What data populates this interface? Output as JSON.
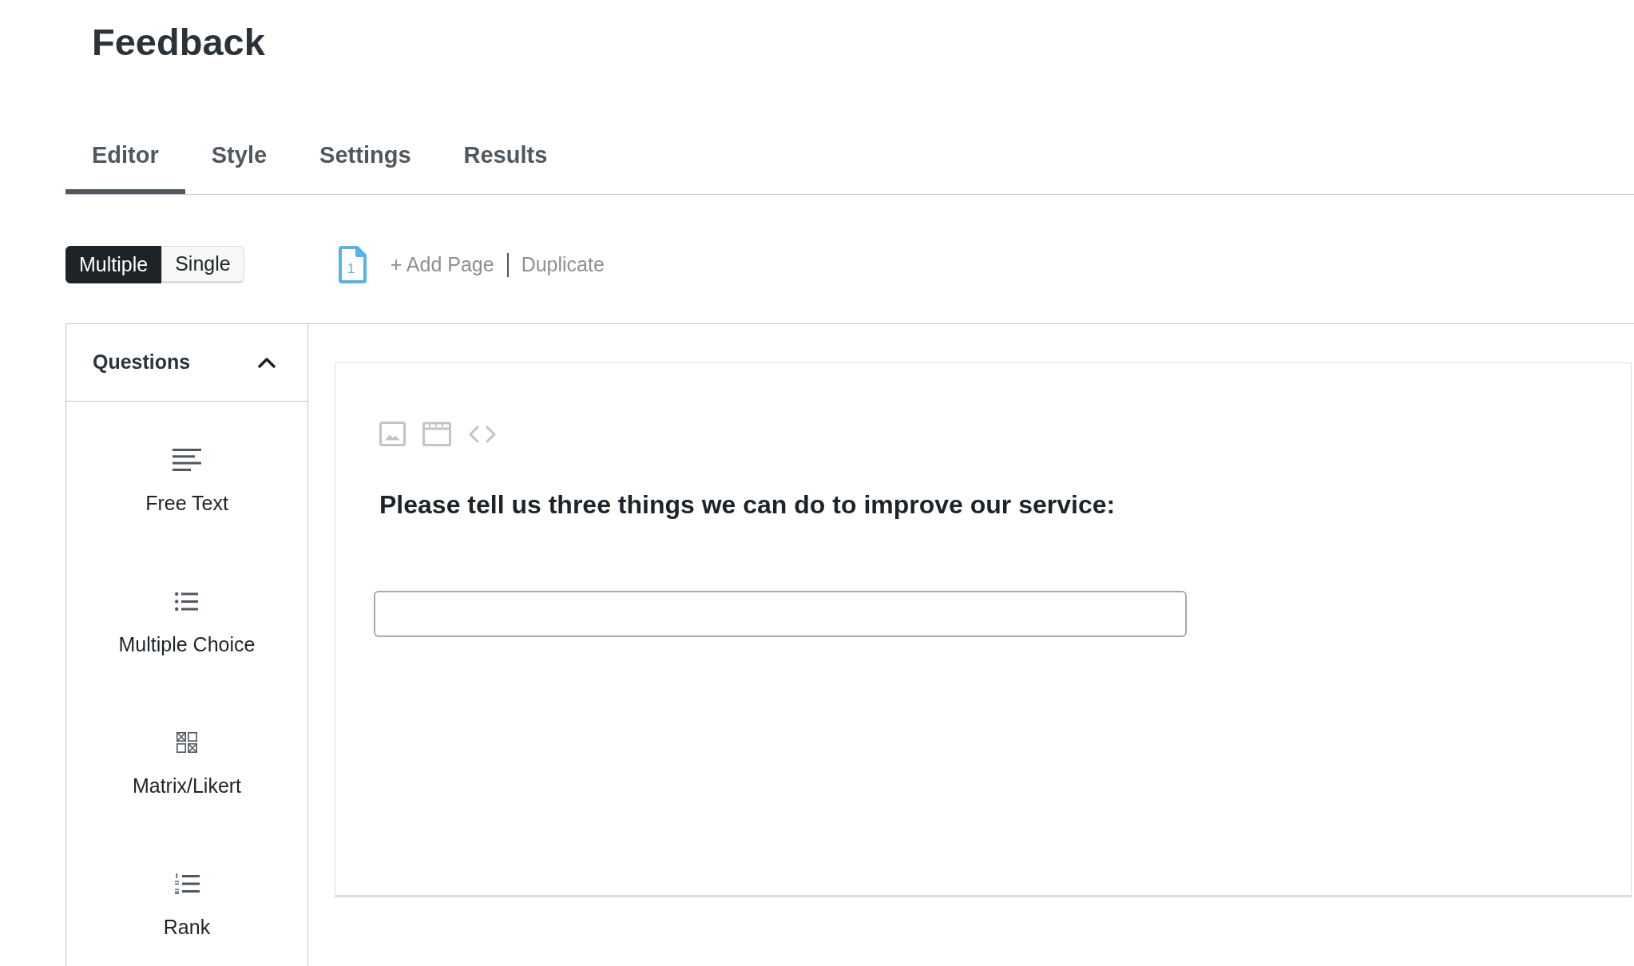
{
  "page": {
    "title": "Feedback"
  },
  "tabs": [
    {
      "label": "Editor",
      "selected": true
    },
    {
      "label": "Style",
      "selected": false
    },
    {
      "label": "Settings",
      "selected": false
    },
    {
      "label": "Results",
      "selected": false
    }
  ],
  "view_mode": [
    {
      "label": "Multiple",
      "selected": true
    },
    {
      "label": "Single",
      "selected": false
    }
  ],
  "page_toolbar": {
    "page_number": "1",
    "actions": [
      {
        "label": "+ Add Page"
      },
      {
        "label": "Duplicate"
      }
    ]
  },
  "sidebar": {
    "title": "Questions",
    "expanded": true,
    "items": [
      {
        "label": "Free Text",
        "kind": "free_text"
      },
      {
        "label": "Multiple Choice",
        "kind": "multiple_choice"
      },
      {
        "label": "Matrix/Likert",
        "kind": "matrix"
      },
      {
        "label": "Rank",
        "kind": "rank"
      }
    ]
  },
  "question_card": {
    "question": "Please tell us three things we can do to improve our service:"
  }
}
